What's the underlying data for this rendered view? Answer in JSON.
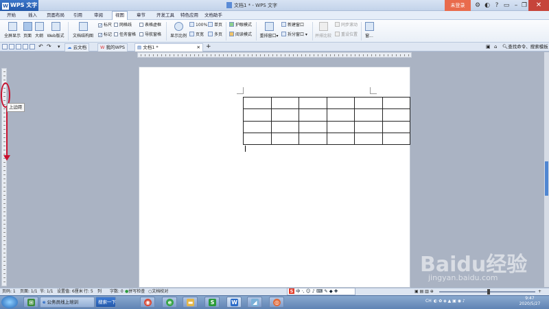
{
  "app": {
    "name": "WPS 文字",
    "doc_title": "文档1 * - WPS 文字",
    "login": "未登录"
  },
  "menu_tabs": [
    "开始",
    "插入",
    "页面布局",
    "引用",
    "审阅",
    "视图",
    "章节",
    "开发工具",
    "特色应用",
    "文档助手"
  ],
  "active_tab": "视图",
  "ribbon": {
    "fullscreen": "全屏显示",
    "page": "页面",
    "outline": "大纲",
    "web": "Web版式",
    "doc_structure": "文档结构图",
    "ruler": "标尺",
    "gridlines": "网格线",
    "table_gridlines": "表格虚框",
    "markup": "标记",
    "task_pane": "任务窗格",
    "nav_pane": "导航窗格",
    "zoom_ratio": "显示比例",
    "zoom_100": "100%",
    "single_page": "单页",
    "page_width": "页宽",
    "multi_page": "多页",
    "eye_mode": "护眼模式",
    "read_mode": "阅读模式",
    "arrange_window": "重排窗口",
    "new_window": "新建窗口",
    "split_window": "拆分窗口",
    "side_by_side": "并排比较",
    "sync_scroll": "同步滚动",
    "reset_position": "重设位置",
    "window": "窗..."
  },
  "doc_tabs": [
    {
      "label": "云文档"
    },
    {
      "label": "我的WPS"
    },
    {
      "label": "文档1 *"
    }
  ],
  "search_hint": "查找命令、搜索模板",
  "tooltip": "上边距",
  "status": {
    "page": "页码: 1",
    "pages": "页面: 1/1",
    "section": "节: 1/1",
    "setting": "设置值: 6厘米",
    "row": "行: 5",
    "col": "列",
    "words": "字数: 0",
    "spell": "拼写检查",
    "doc_check": "文档校对"
  },
  "ime": {
    "s": "S",
    "label": "中"
  },
  "taskbar": {
    "item1": "公务员线上培训",
    "search_btn": "搜索一下",
    "time": "9:47",
    "date": "2020/5/27",
    "tray": "CH"
  },
  "watermark": {
    "logo": "Baidu经验",
    "url": "jingyan.baidu.com"
  },
  "colors": {
    "accent": "#2459aa",
    "red_annotation": "#c8102e",
    "login": "#e96b4c"
  }
}
